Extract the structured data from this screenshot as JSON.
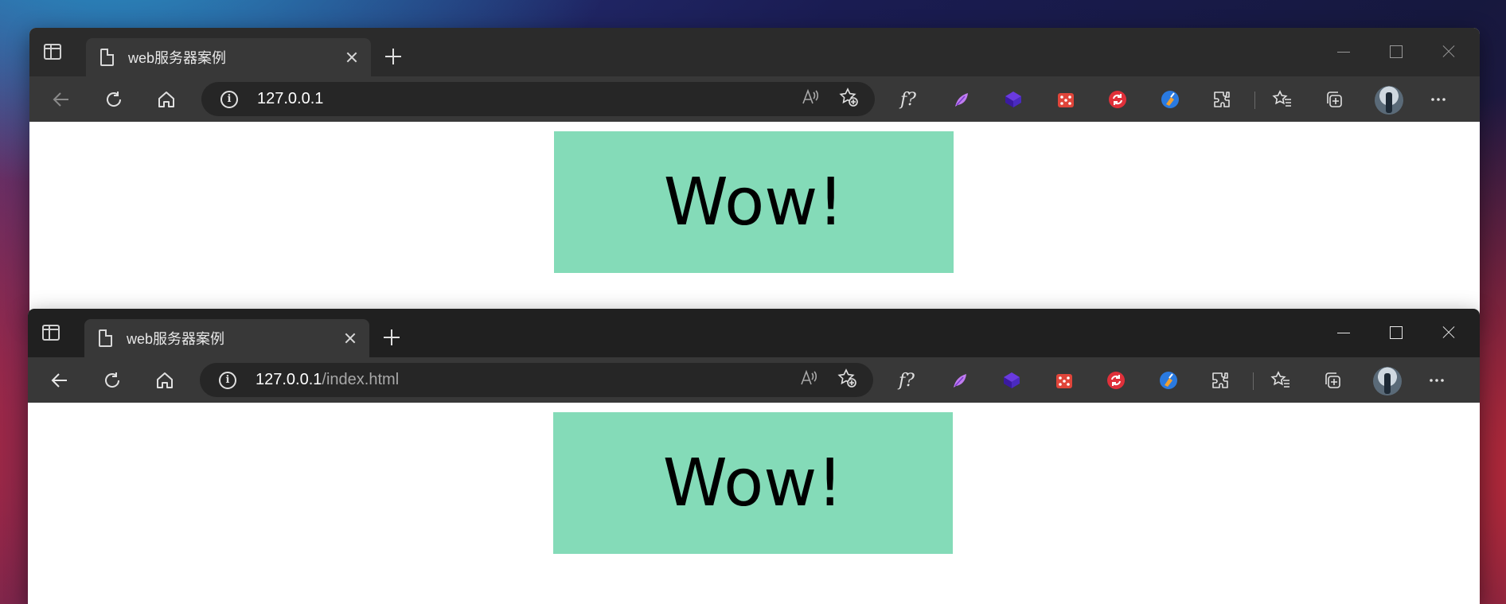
{
  "windows": [
    {
      "tab_title": "web服务器案例",
      "url_host": "127.0.0.1",
      "url_path": "",
      "page_text": "Wow!"
    },
    {
      "tab_title": "web服务器案例",
      "url_host": "127.0.0.1",
      "url_path": "/index.html",
      "page_text": "Wow!"
    }
  ],
  "toolbar_icons": [
    "back-icon",
    "refresh-icon",
    "home-icon",
    "info-icon",
    "read-aloud-icon",
    "add-favorite-icon",
    "formula-extension-icon",
    "extension-feather-icon",
    "extension-cube-icon",
    "extension-dice-icon",
    "extension-sync-icon",
    "extension-broom-icon",
    "extensions-icon",
    "favorites-icon",
    "collections-icon",
    "profile-avatar",
    "more-icon"
  ],
  "extension_f_label": "f?",
  "colors": {
    "page_box": "#84dbb8",
    "titlebar": "#202020",
    "toolbar": "#383838"
  }
}
